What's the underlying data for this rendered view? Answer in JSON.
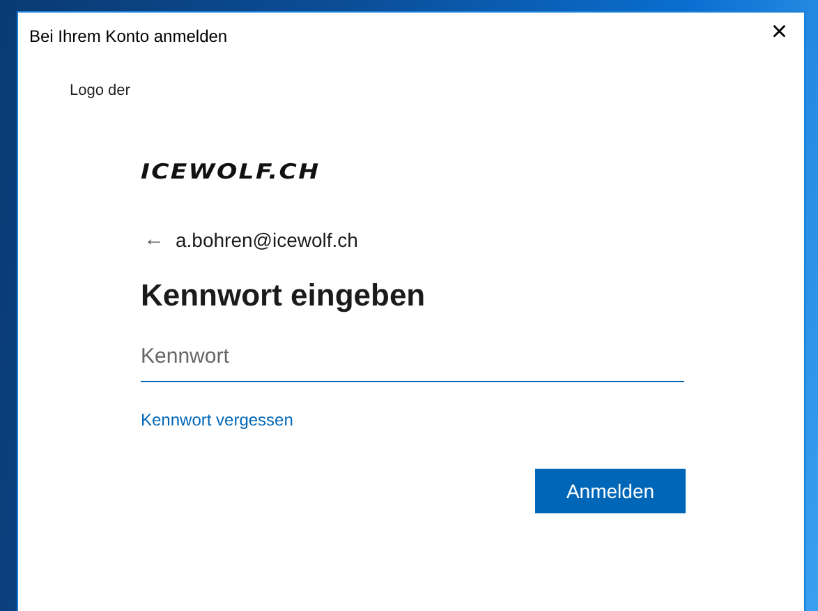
{
  "window": {
    "title": "Bei Ihrem Konto anmelden",
    "close": "×"
  },
  "logo_alt": "Logo der",
  "logo": "ICEWOLF.CH",
  "account": {
    "back": "←",
    "email": "a.bohren@icewolf.ch"
  },
  "heading": "Kennwort eingeben",
  "password": {
    "placeholder": "Kennwort"
  },
  "forgot_link": "Kennwort vergessen",
  "buttons": [
    "Anmelden"
  ]
}
